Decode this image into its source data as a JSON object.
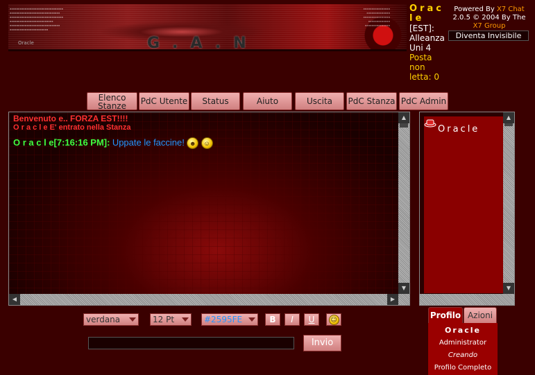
{
  "banner": {
    "name": "Oracle",
    "logo": "G.A.N"
  },
  "user_info": {
    "username": "Oracle",
    "line1": "[EST]:",
    "line2": "Alleanza",
    "line3": "Uni 4",
    "unread_label": "Posta non letta: 0"
  },
  "powered_by": {
    "prefix": "Powered By",
    "product": "X7 Chat",
    "version": "2.0.5",
    "copyright": "© 2004 By The",
    "group": "X7 Group"
  },
  "invisible_button": "Diventa Invisibile",
  "nav": {
    "room_list": "Elenco Stanze",
    "user_cp": "PdC Utente",
    "status": "Status",
    "help": "Aiuto",
    "logout": "Uscita",
    "room_cp": "PdC Stanza",
    "admin_cp": "PdC Admin"
  },
  "chat": {
    "welcome": "Benvenuto e.. FORZA EST!!!!",
    "entered": "O r a c l e E' entrato nella Stanza",
    "message": {
      "user": "O r a c l e",
      "time": "[7:16:16 PM]:",
      "text": "Uppate le faccine!"
    }
  },
  "userlist": {
    "users": [
      {
        "name": "Oracle"
      }
    ]
  },
  "controls": {
    "font": "verdana",
    "size": "12 Pt",
    "color": "#2595FE",
    "bold": "B",
    "italic": "I",
    "underline": "U",
    "send": "Invio",
    "message_value": ""
  },
  "profile": {
    "tab_profile": "Profilo",
    "tab_actions": "Azioni",
    "name": "Oracle",
    "role": "Administrator",
    "status": "Creando",
    "full_profile": "Profilo Completo"
  },
  "colors": {
    "background": "#3a0000",
    "accent_pink": "#e0a0a0",
    "message_blue": "#2595FE",
    "username_green": "#40ff40",
    "system_red": "#ff3030",
    "highlight_yellow": "#ffd000"
  }
}
